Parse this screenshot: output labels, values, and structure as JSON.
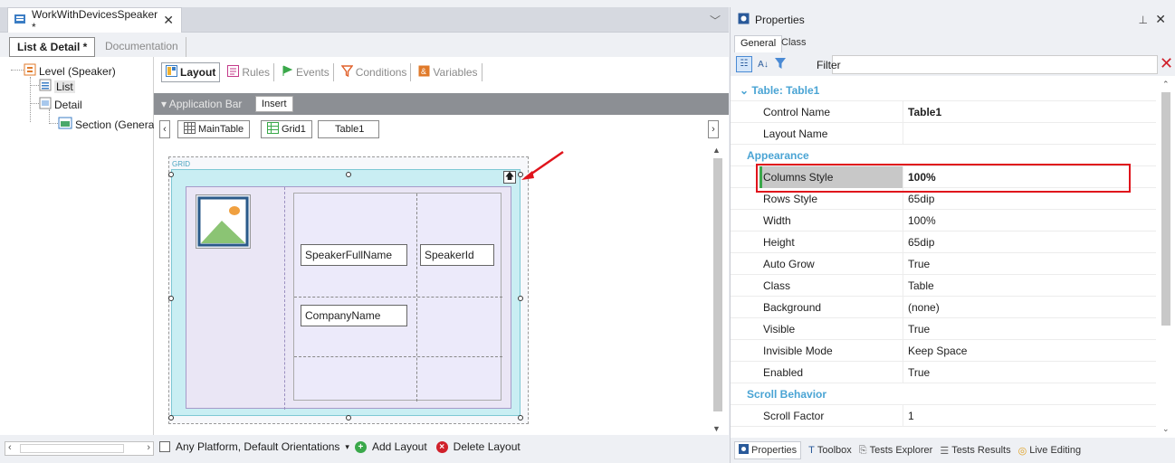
{
  "doc_tab": {
    "title": "WorkWithDevicesSpeaker *",
    "close": "✕"
  },
  "subtabs": {
    "list_detail": "List & Detail *",
    "documentation": "Documentation"
  },
  "tree": {
    "level": "Level (Speaker)",
    "list": "List",
    "detail": "Detail",
    "section": "Section (Genera"
  },
  "toolbar": {
    "layout": "Layout",
    "rules": "Rules",
    "events": "Events",
    "conditions": "Conditions",
    "variables": "Variables"
  },
  "appbar": {
    "label": "▾ Application Bar",
    "insert": "Insert"
  },
  "breadcrumb": {
    "main_table": "MainTable",
    "grid": "Grid1",
    "table": "Table1"
  },
  "canvas": {
    "grid_label": "GRID",
    "fields": {
      "speaker_full_name": "SpeakerFullName",
      "speaker_id": "SpeakerId",
      "company_name": "CompanyName"
    }
  },
  "bottombar": {
    "platform": "Any Platform, Default Orientations",
    "add_layout": "Add Layout",
    "delete_layout": "Delete Layout"
  },
  "properties": {
    "title": "Properties",
    "tabs": [
      "General",
      "Class"
    ],
    "filter_label": "Filter",
    "section_table": "Table: Table1",
    "rows": [
      {
        "k": "Control Name",
        "v": "Table1",
        "bold": true
      },
      {
        "k": "Layout Name",
        "v": ""
      },
      {
        "section": "Appearance"
      },
      {
        "k": "Columns Style",
        "v": "100%",
        "bold": true,
        "selected": true
      },
      {
        "k": "Rows Style",
        "v": "65dip"
      },
      {
        "k": "Width",
        "v": "100%"
      },
      {
        "k": "Height",
        "v": "65dip"
      },
      {
        "k": "Auto Grow",
        "v": "True"
      },
      {
        "k": "Class",
        "v": "Table"
      },
      {
        "k": "Background",
        "v": "(none)"
      },
      {
        "k": "Visible",
        "v": "True"
      },
      {
        "k": "Invisible Mode",
        "v": "Keep Space"
      },
      {
        "k": "Enabled",
        "v": "True"
      },
      {
        "section": "Scroll Behavior"
      },
      {
        "k": "Scroll Factor",
        "v": "1"
      }
    ],
    "bottom_tabs": [
      "Properties",
      "Toolbox",
      "Tests Explorer",
      "Tests Results",
      "Live Editing"
    ]
  },
  "colors": {
    "accent": "#4aa4d4",
    "highlight": "#e0141c"
  }
}
